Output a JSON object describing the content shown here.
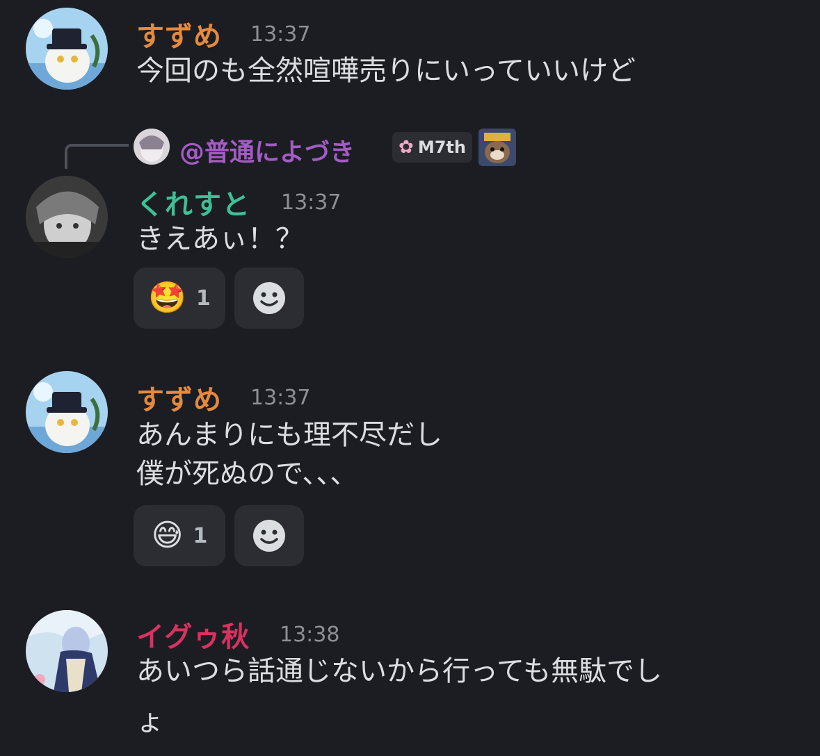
{
  "messages": [
    {
      "author": "すずめ",
      "author_color": "#e58a3e",
      "time": "13:37",
      "lines": [
        "今回のも全然喧嘩売りにいっていいけど"
      ]
    },
    {
      "reply": {
        "mention": "@普通によづき",
        "mention_color": "#a25cc4",
        "badge_icon": "cherry-blossom-icon",
        "badge_text": "M7th"
      },
      "author": "くれすと",
      "author_color": "#3fbf96",
      "time": "13:37",
      "lines": [
        "きえあぃ！？"
      ],
      "reactions": [
        {
          "emoji": "🤩",
          "count": "1"
        }
      ]
    },
    {
      "author": "すずめ",
      "author_color": "#e58a3e",
      "time": "13:37",
      "lines": [
        "あんまりにも理不尽だし",
        "僕が死ぬので、、、"
      ],
      "reactions": [
        {
          "emoji": "😅",
          "count": "1"
        }
      ]
    },
    {
      "author": "イグゥ秋",
      "author_color": "#d9325f",
      "time": "13:38",
      "lines": [
        "あいつら話通じないから行っても無駄でし",
        "ょ"
      ]
    }
  ],
  "icons": {
    "add_reaction": "smiley-add-reaction-icon"
  }
}
